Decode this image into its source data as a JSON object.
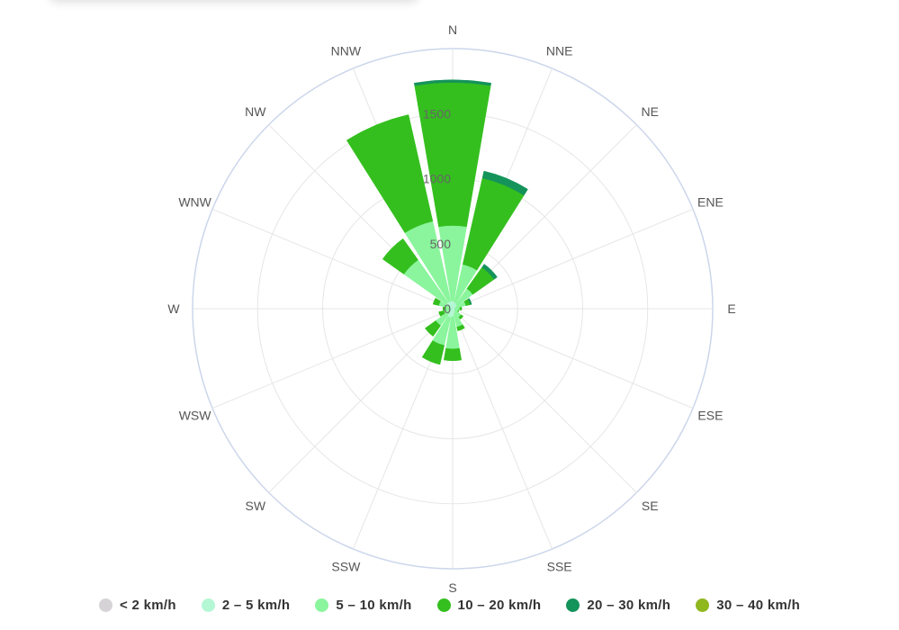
{
  "chart_data": {
    "type": "bar",
    "subtype": "polar-stacked-windrose",
    "categories": [
      "N",
      "NNE",
      "NE",
      "ENE",
      "E",
      "ESE",
      "SE",
      "SSE",
      "S",
      "SSW",
      "SW",
      "WSW",
      "W",
      "WNW",
      "NW",
      "NNW"
    ],
    "series": [
      {
        "name": "< 2 km/h",
        "color": "#d6d3d6",
        "values": [
          0,
          0,
          0,
          0,
          0,
          0,
          0,
          0,
          0,
          0,
          0,
          0,
          0,
          0,
          0,
          0
        ]
      },
      {
        "name": "2 – 5 km/h",
        "color": "#b4f7d4",
        "values": [
          60,
          50,
          40,
          25,
          15,
          15,
          20,
          35,
          60,
          70,
          40,
          20,
          15,
          20,
          60,
          60
        ]
      },
      {
        "name": "5 – 10 km/h",
        "color": "#8af59c",
        "values": [
          580,
          300,
          150,
          80,
          40,
          30,
          60,
          110,
          250,
          220,
          120,
          50,
          40,
          90,
          400,
          630
        ]
      },
      {
        "name": "10 – 20 km/h",
        "color": "#34bf1e",
        "values": [
          1100,
          680,
          200,
          35,
          15,
          5,
          20,
          30,
          90,
          150,
          100,
          40,
          20,
          45,
          200,
          840
        ]
      },
      {
        "name": "20 – 30 km/h",
        "color": "#14935a",
        "values": [
          20,
          55,
          30,
          10,
          0,
          0,
          0,
          0,
          0,
          0,
          0,
          0,
          0,
          0,
          0,
          0
        ]
      },
      {
        "name": "30 – 40 km/h",
        "color": "#8fb71e",
        "values": [
          0,
          0,
          0,
          0,
          0,
          0,
          0,
          0,
          0,
          0,
          0,
          0,
          0,
          0,
          0,
          0
        ]
      }
    ],
    "radial_ticks": [
      0,
      500,
      1000,
      1500
    ],
    "rlim": [
      0,
      2000
    ],
    "legend_position": "bottom",
    "grid": true
  }
}
